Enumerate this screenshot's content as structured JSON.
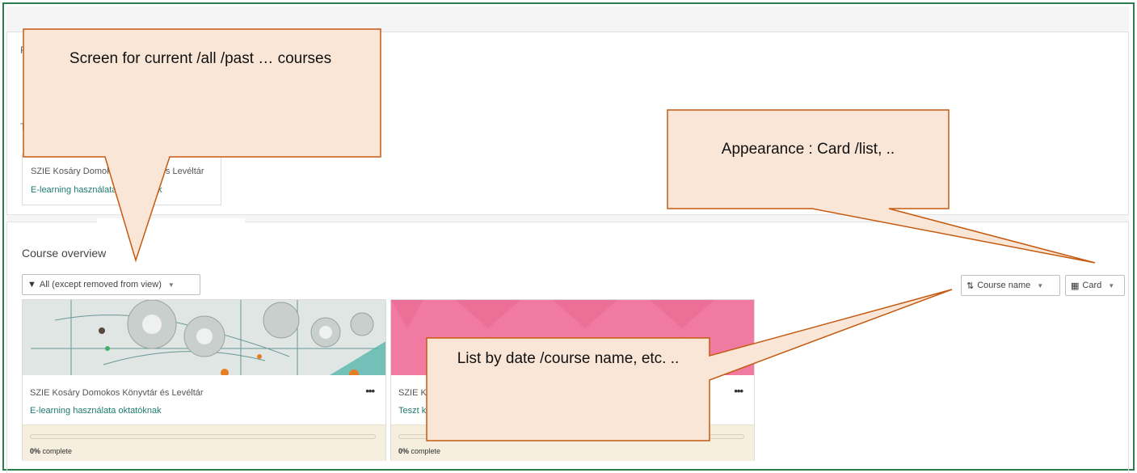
{
  "recent": {
    "peek_letter": "F",
    "peek_letter2": "T",
    "mini_card": {
      "category": "SZIE Kosáry Domokos Könyvtár és Levéltár",
      "course_name": "E-learning használata oktatóknak"
    }
  },
  "overview": {
    "title": "Course overview",
    "filter_label": "All (except removed from view)",
    "sort_label": "Course name",
    "view_label": "Card"
  },
  "courses": [
    {
      "category": "SZIE Kosáry Domokos Könyvtár és Levéltár",
      "name": "E-learning használata oktatóknak",
      "progress_percent": 0,
      "progress_value": "0%",
      "progress_suffix": " complete"
    },
    {
      "category": "SZIE Kosáry Domokos Könyvtár és Levéltár",
      "name": "Teszt kurzus",
      "progress_percent": 0,
      "progress_value": "0%",
      "progress_suffix": " complete"
    }
  ],
  "callouts": {
    "screen": "Screen for current /all /past … courses",
    "appearance": "Appearance : Card /list, ..",
    "list_by": "List by date /course name, etc. .."
  },
  "colors": {
    "frame": "#2e7d4f",
    "link": "#1e7a72",
    "callout_fill": "#f9e6d6",
    "callout_stroke": "#c55a11",
    "card_footer": "#f6efdf",
    "pink_banner": "#f07aa2"
  }
}
